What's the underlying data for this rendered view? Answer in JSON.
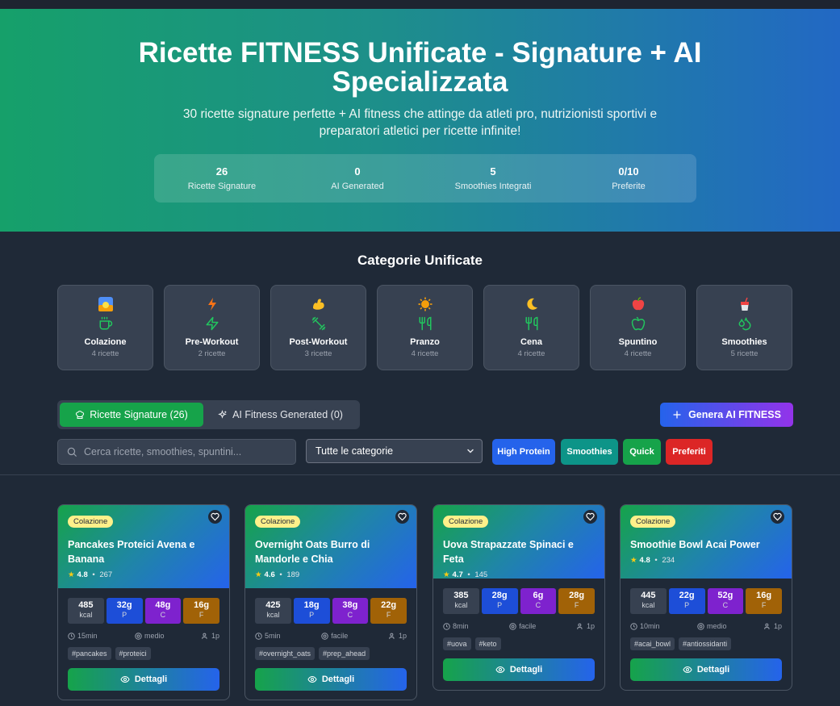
{
  "hero": {
    "title": "Ricette FITNESS Unificate - Signature + AI Specializzata",
    "subtitle": "30 ricette signature perfette + AI fitness che attinge da atleti pro, nutrizionisti sportivi e preparatori atletici per ricette infinite!",
    "stats": [
      {
        "value": "26",
        "label": "Ricette Signature"
      },
      {
        "value": "0",
        "label": "AI Generated"
      },
      {
        "value": "5",
        "label": "Smoothies Integrati"
      },
      {
        "value": "0/10",
        "label": "Preferite"
      }
    ]
  },
  "categories": {
    "title": "Categorie Unificate",
    "items": [
      {
        "emoji": "🌅",
        "icon": "coffee-icon",
        "name": "Colazione",
        "count": "4 ricette"
      },
      {
        "emoji": "⚡",
        "icon": "zap-icon",
        "name": "Pre-Workout",
        "count": "2 ricette"
      },
      {
        "emoji": "💪",
        "icon": "dumbbell-icon",
        "name": "Post-Workout",
        "count": "3 ricette"
      },
      {
        "emoji": "🌞",
        "icon": "utensils-icon",
        "name": "Pranzo",
        "count": "4 ricette"
      },
      {
        "emoji": "🌙",
        "icon": "utensils-icon",
        "name": "Cena",
        "count": "4 ricette"
      },
      {
        "emoji": "🍎",
        "icon": "apple-icon",
        "name": "Spuntino",
        "count": "4 ricette"
      },
      {
        "emoji": "🥤",
        "icon": "droplets-icon",
        "name": "Smoothies",
        "count": "5 ricette"
      }
    ]
  },
  "tabs": {
    "signature": "Ricette Signature (26)",
    "ai": "AI Fitness Generated (0)"
  },
  "generate_button": "Genera AI FITNESS",
  "search": {
    "placeholder": "Cerca ricette, smoothies, spuntini..."
  },
  "filter": {
    "selected": "Tutte le categorie"
  },
  "chips": [
    {
      "label": "High Protein",
      "color": "#2563eb"
    },
    {
      "label": "Smoothies",
      "color": "#0d9488"
    },
    {
      "label": "Quick",
      "color": "#16a34a"
    },
    {
      "label": "Preferiti",
      "color": "#dc2626"
    }
  ],
  "recipes": [
    {
      "category": "Colazione",
      "title": "Pancakes Proteici Avena e Banana",
      "rating": "4.8",
      "reviews": "267",
      "kcal": "485",
      "kcal_label": "kcal",
      "p": "32g",
      "c": "48g",
      "f": "16g",
      "p_label": "P",
      "c_label": "C",
      "f_label": "F",
      "time": "15min",
      "difficulty": "medio",
      "servings": "1p",
      "tags": [
        "#pancakes",
        "#proteici"
      ],
      "button": "Dettagli"
    },
    {
      "category": "Colazione",
      "title": "Overnight Oats Burro di Mandorle e Chia",
      "rating": "4.6",
      "reviews": "189",
      "kcal": "425",
      "kcal_label": "kcal",
      "p": "18g",
      "c": "38g",
      "f": "22g",
      "p_label": "P",
      "c_label": "C",
      "f_label": "F",
      "time": "5min",
      "difficulty": "facile",
      "servings": "1p",
      "tags": [
        "#overnight_oats",
        "#prep_ahead"
      ],
      "button": "Dettagli"
    },
    {
      "category": "Colazione",
      "title": "Uova Strapazzate Spinaci e Feta",
      "rating": "4.7",
      "reviews": "145",
      "kcal": "385",
      "kcal_label": "kcal",
      "p": "28g",
      "c": "6g",
      "f": "28g",
      "p_label": "P",
      "c_label": "C",
      "f_label": "F",
      "time": "8min",
      "difficulty": "facile",
      "servings": "1p",
      "tags": [
        "#uova",
        "#keto"
      ],
      "button": "Dettagli"
    },
    {
      "category": "Colazione",
      "title": "Smoothie Bowl Acai Power",
      "rating": "4.8",
      "reviews": "234",
      "kcal": "445",
      "kcal_label": "kcal",
      "p": "22g",
      "c": "52g",
      "f": "16g",
      "p_label": "P",
      "c_label": "C",
      "f_label": "F",
      "time": "10min",
      "difficulty": "medio",
      "servings": "1p",
      "tags": [
        "#acai_bowl",
        "#antiossidanti"
      ],
      "button": "Dettagli"
    }
  ]
}
